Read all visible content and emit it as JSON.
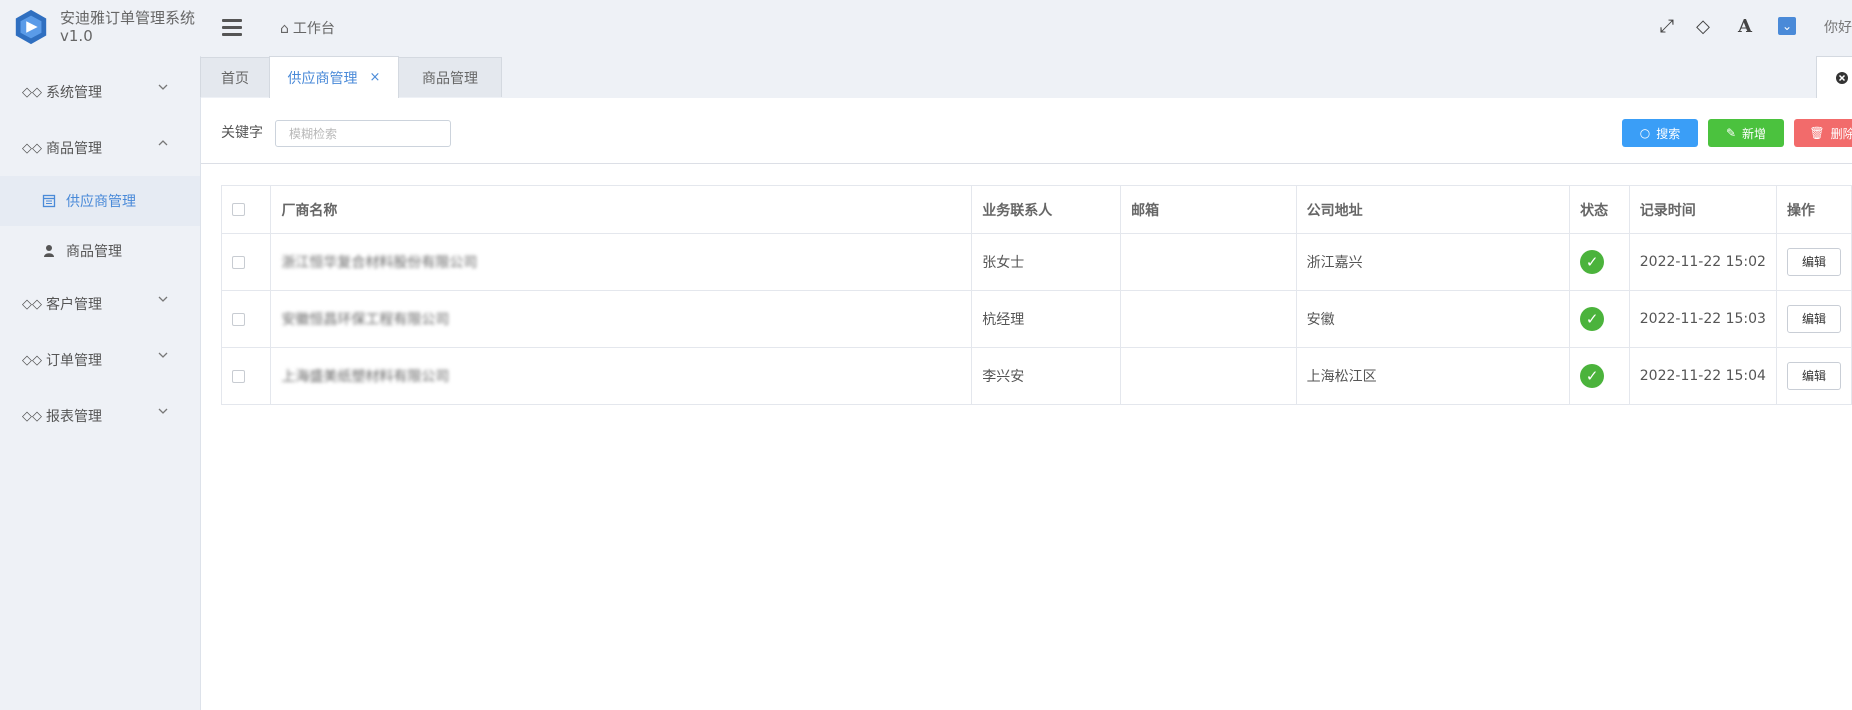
{
  "app": {
    "title_line1": "安迪雅订单管理系统",
    "title_line2": "v1.0",
    "accent": "#4a8ad8"
  },
  "sidebar": {
    "items": [
      {
        "label": "系统管理",
        "icon": "diamond-links-icon",
        "expanded": false
      },
      {
        "label": "商品管理",
        "icon": "diamond-links-icon",
        "expanded": true
      },
      {
        "label": "客户管理",
        "icon": "diamond-links-icon",
        "expanded": false
      },
      {
        "label": "订单管理",
        "icon": "diamond-links-icon",
        "expanded": false
      },
      {
        "label": "报表管理",
        "icon": "diamond-links-icon",
        "expanded": false
      }
    ],
    "subitems": [
      {
        "label": "供应商管理",
        "icon": "calendar-icon",
        "active": true
      },
      {
        "label": "商品管理",
        "icon": "user-icon",
        "active": false
      }
    ]
  },
  "header": {
    "breadcrumb": "工作台",
    "hello": "你好"
  },
  "tabs": [
    {
      "label": "首页"
    },
    {
      "label": "供应商管理",
      "close": "×",
      "active": true
    },
    {
      "label": "商品管理"
    }
  ],
  "toolbar": {
    "keyword_label": "关键字",
    "keyword_placeholder": "模糊检索",
    "search_label": "搜索",
    "add_label": "新增",
    "delete_label": "删除",
    "search_color": "#3a9ef7",
    "add_color": "#4bc23e",
    "delete_color": "#f26b6b"
  },
  "table": {
    "columns": [
      "厂商名称",
      "业务联系人",
      "邮箱",
      "公司地址",
      "状态",
      "记录时间",
      "操作"
    ],
    "rows": [
      {
        "name": "浙江恒华复合材料股份有限公司",
        "contact": "张女士",
        "email": "",
        "address": "浙江嘉兴",
        "time": "2022-11-22 15:02",
        "action": "编辑"
      },
      {
        "name": "安徽恒昌环保工程有限公司",
        "contact": "杭经理",
        "email": "",
        "address": "安徽",
        "time": "2022-11-22 15:03",
        "action": "编辑"
      },
      {
        "name": "上海盛美纸塑材料有限公司",
        "contact": "李兴安",
        "email": "",
        "address": "上海松江区",
        "time": "2022-11-22 15:04",
        "action": "编辑"
      }
    ]
  }
}
